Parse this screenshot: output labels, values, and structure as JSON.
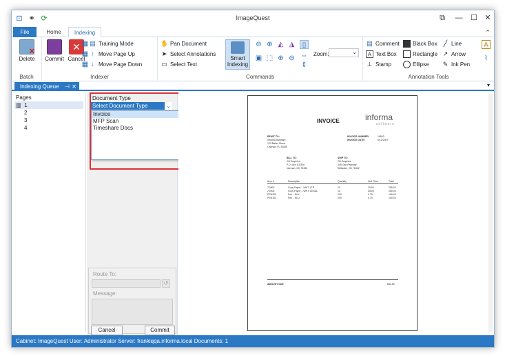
{
  "window": {
    "title": "ImageQuest"
  },
  "tabs": {
    "file": "File",
    "home": "Home",
    "indexing": "Indexing"
  },
  "ribbon": {
    "batch": {
      "label": "Batch",
      "delete": "Delete"
    },
    "indexer": {
      "label": "Indexer",
      "commit": "Commit",
      "cancel": "Cancel",
      "training_mode": "Training Mode",
      "move_up": "Move Page Up",
      "move_down": "Move Page Down"
    },
    "commands": {
      "label": "Commands",
      "pan": "Pan Document",
      "select_annotations": "Select Annotations",
      "select_text": "Select Text",
      "smart_indexing_1": "Smart",
      "smart_indexing_2": "Indexing",
      "zoom_label": "Zoom:",
      "zoom_value": ""
    },
    "annotations": {
      "label": "Annotation Tools",
      "comment": "Comment",
      "text_box": "Text Box",
      "stamp": "Stamp",
      "black_box": "Black Box",
      "rectangle": "Rectangle",
      "ellipse": "Ellipse",
      "line": "Line",
      "arrow": "Arrow",
      "ink_pen": "Ink Pen"
    }
  },
  "panel": {
    "tab_label": "Indexing Queue"
  },
  "pages": {
    "header": "Pages",
    "items": [
      "1",
      "2",
      "3",
      "4"
    ]
  },
  "form": {
    "doc_type_label": "Document Type",
    "doc_type_value": "Select Document Type",
    "options": [
      "Invoice",
      "MFP Scan",
      "Timeshare Docs"
    ],
    "route_label": "Route To:",
    "message_label": "Message:",
    "cancel": "Cancel",
    "commit": "Commit"
  },
  "invoice": {
    "title": "INVOICE",
    "logo": "informa",
    "logo_sub": "software",
    "remit_to": "REMIT TO:",
    "remit_lines": [
      "Informa Software",
      "123 Baker Street",
      "Orlando, FL 32830"
    ],
    "inv_num_label": "INVOICE NUMBER:",
    "inv_num": "16543",
    "inv_date_label": "INVOICE DATE:",
    "inv_date": "5/12/2007",
    "bill_to": "BILL TO:",
    "bill_lines": [
      "G8 Graphics",
      "P.O. Box 102330",
      "Norman, OK 75432"
    ],
    "ship_to": "SHIP TO:",
    "ship_lines": [
      "G8 Graphics",
      "345 Oak Parkway",
      "Stillwater, OK 75422"
    ],
    "columns": [
      "Item #",
      "Description",
      "Quantity",
      "Unit Price",
      "Total"
    ],
    "rows": [
      [
        "7G802",
        "Copy Paper – WHT, LTR",
        "10",
        "25.50",
        "255.00"
      ],
      [
        "7G902",
        "Copy Paper – WHT, LEGAL",
        "10",
        "28.00",
        "280.00"
      ],
      [
        "PEN200",
        "Pen – BLK",
        "200",
        "0.75",
        "150.00"
      ],
      [
        "PEN102",
        "Pen – BLU",
        "200",
        "0.75",
        "150.00"
      ]
    ],
    "amount_due_label": "AMOUNT DUE",
    "amount_due": "$32.50"
  },
  "status": {
    "text": "Cabinet: ImageQuest   User: Administrator   Server: frankiqqa.informa.local   Documents: 1"
  },
  "colors": {
    "accent": "#2b78c4",
    "highlight": "#e03030"
  }
}
